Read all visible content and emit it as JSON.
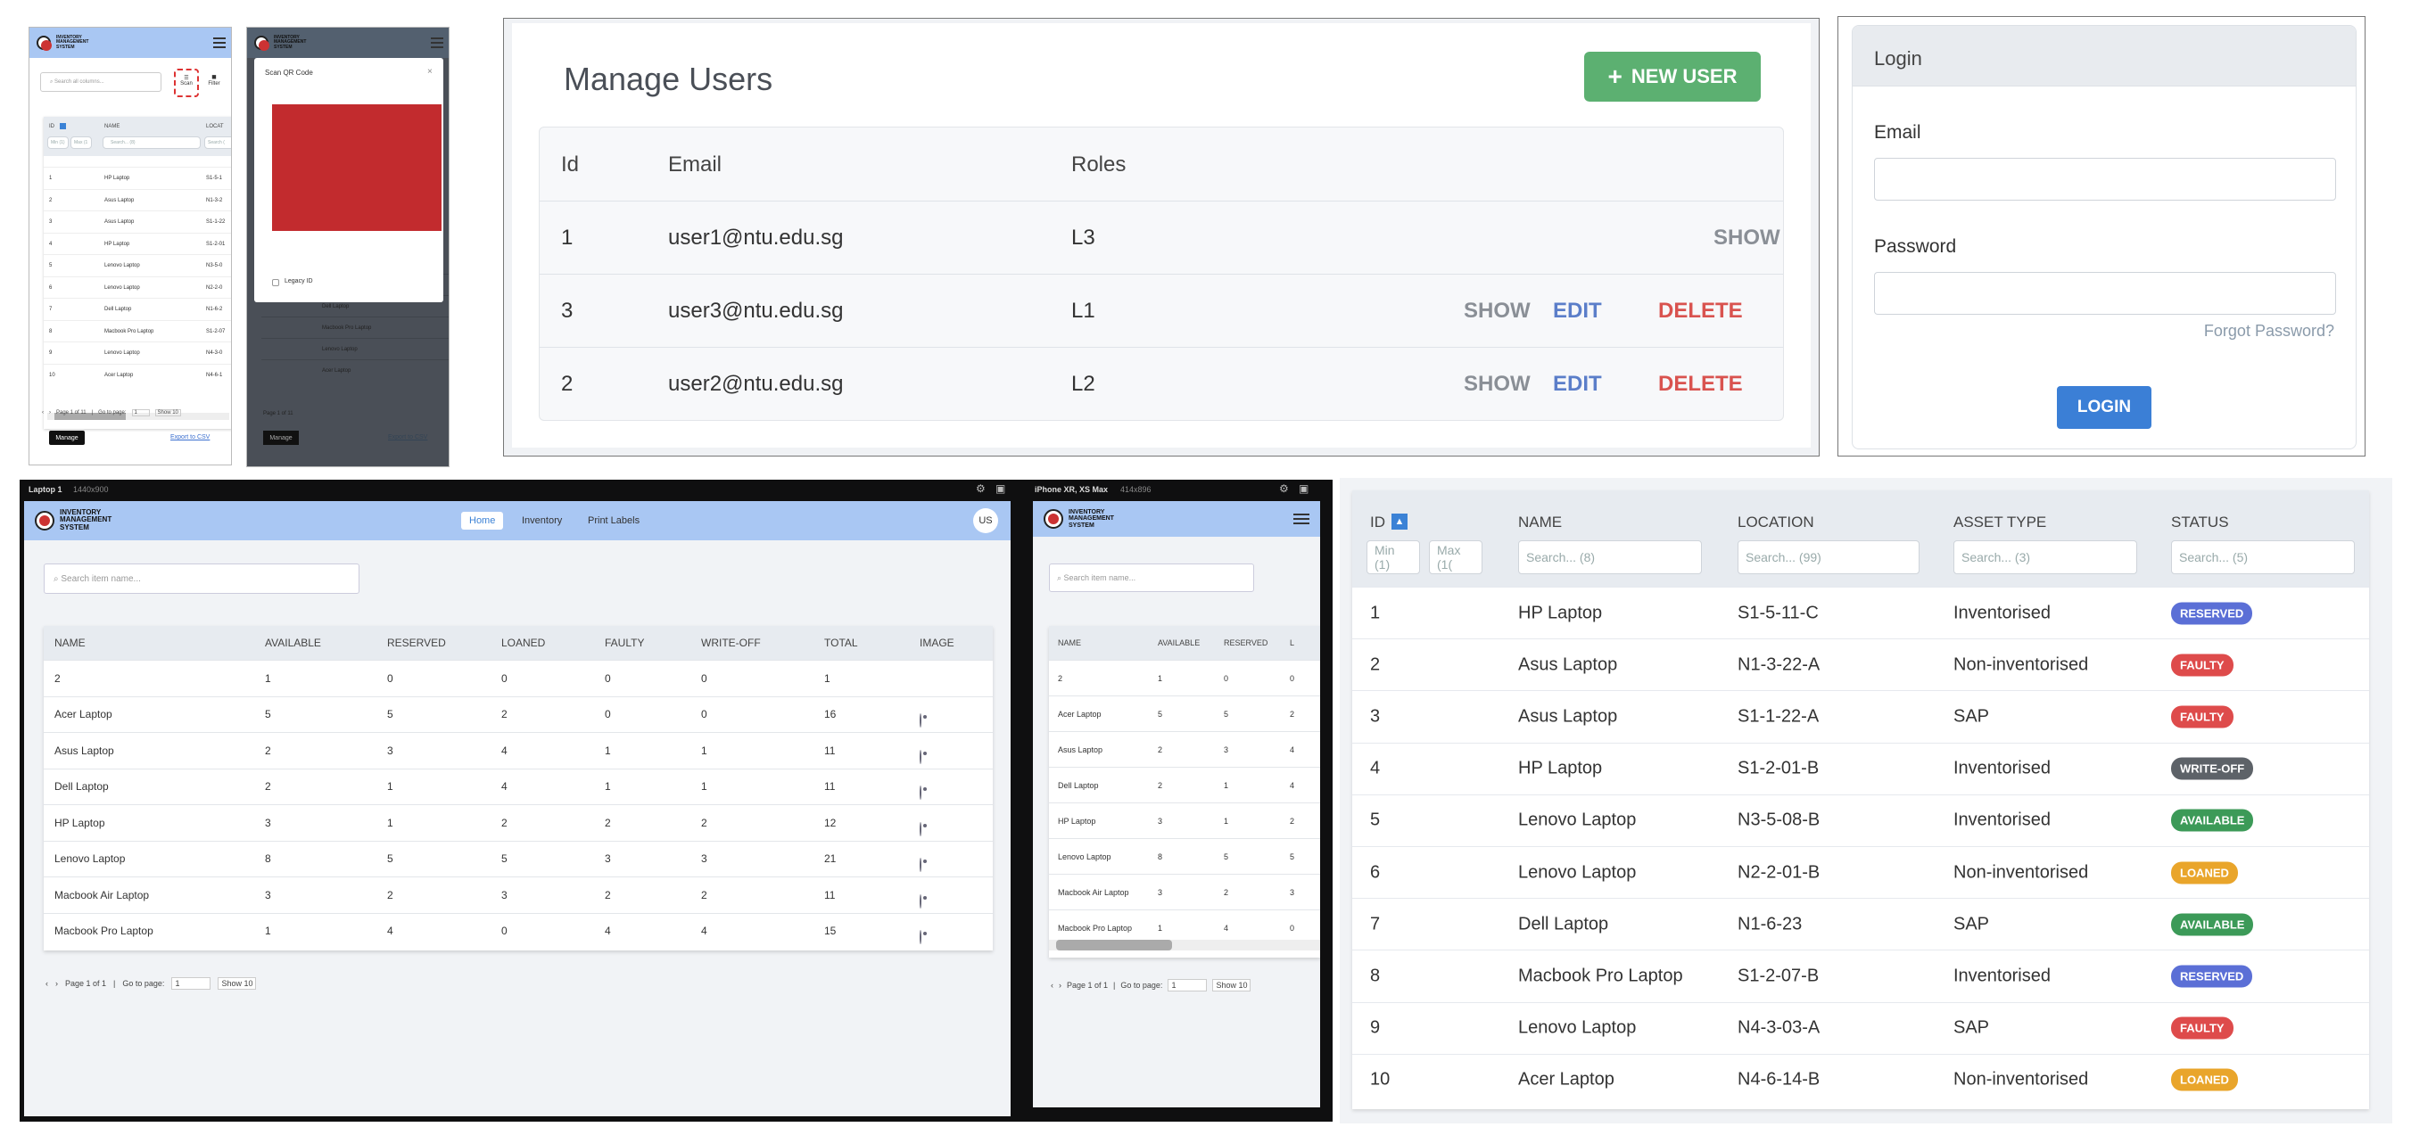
{
  "mobile1": {
    "logo": "INVENTORY MANAGEMENT SYSTEM",
    "search_placeholder": "Search all columns...",
    "scan_label": "Scan",
    "filter_label": "Filter",
    "headers": [
      "ID",
      "NAME",
      "LOCAT"
    ],
    "min": "Min (1)",
    "max": "Max (1",
    "name_ph": "Search... (8)",
    "loc_ph": "Search (",
    "rows": [
      {
        "id": "1",
        "name": "HP Laptop",
        "loc": "S1-5-1"
      },
      {
        "id": "2",
        "name": "Asus Laptop",
        "loc": "N1-3-2"
      },
      {
        "id": "3",
        "name": "Asus Laptop",
        "loc": "S1-1-22"
      },
      {
        "id": "4",
        "name": "HP Laptop",
        "loc": "S1-2-01"
      },
      {
        "id": "5",
        "name": "Lenovo Laptop",
        "loc": "N3-5-0"
      },
      {
        "id": "6",
        "name": "Lenovo Laptop",
        "loc": "N2-2-0"
      },
      {
        "id": "7",
        "name": "Dell Laptop",
        "loc": "N1-6-2"
      },
      {
        "id": "8",
        "name": "Macbook Pro Laptop",
        "loc": "S1-2-07"
      },
      {
        "id": "9",
        "name": "Lenovo Laptop",
        "loc": "N4-3-0"
      },
      {
        "id": "10",
        "name": "Acer Laptop",
        "loc": "N4-6-1"
      }
    ],
    "pager": "Page 1 of 11",
    "goto": "Go to page:",
    "goto_val": "1",
    "show": "Show 10",
    "manage": "Manage",
    "export": "Export to CSV"
  },
  "mobile2": {
    "logo": "INVENTORY MANAGEMENT SYSTEM",
    "modal_title": "Scan QR Code",
    "close": "×",
    "legacy": "Legacy ID",
    "manage": "Manage",
    "export": "Export to CSV",
    "pager": "Page 1 of 11",
    "rows": [
      "Lenovo Laptop",
      "Dell Laptop",
      "Macbook Pro Laptop",
      "Lenovo Laptop",
      "Acer Laptop"
    ]
  },
  "manage_users": {
    "title": "Manage Users",
    "new_user": "NEW USER",
    "headers": {
      "id": "Id",
      "email": "Email",
      "roles": "Roles"
    },
    "rows": [
      {
        "id": "1",
        "email": "user1@ntu.edu.sg",
        "role": "L3",
        "actions": [
          "SHOW"
        ]
      },
      {
        "id": "3",
        "email": "user3@ntu.edu.sg",
        "role": "L1",
        "actions": [
          "SHOW",
          "EDIT",
          "DELETE"
        ]
      },
      {
        "id": "2",
        "email": "user2@ntu.edu.sg",
        "role": "L2",
        "actions": [
          "SHOW",
          "EDIT",
          "DELETE"
        ]
      }
    ],
    "colors": {
      "show": "#8a8f96",
      "edit": "#5b7ec9",
      "delete": "#d9534f",
      "button": "#5cb071"
    }
  },
  "login": {
    "title": "Login",
    "email_label": "Email",
    "password_label": "Password",
    "forgot": "Forgot Password?",
    "button": "LOGIN"
  },
  "laptop": {
    "device": "Laptop 1",
    "size": "1440x900",
    "logo": "INVENTORY MANAGEMENT SYSTEM",
    "nav": [
      "Home",
      "Inventory",
      "Print Labels"
    ],
    "avatar": "US",
    "search_placeholder": "Search item name...",
    "headers": [
      "NAME",
      "AVAILABLE",
      "RESERVED",
      "LOANED",
      "FAULTY",
      "WRITE-OFF",
      "TOTAL",
      "IMAGE"
    ],
    "rows": [
      [
        "2",
        "1",
        "0",
        "0",
        "0",
        "0",
        "1"
      ],
      [
        "Acer Laptop",
        "5",
        "5",
        "2",
        "0",
        "0",
        "16"
      ],
      [
        "Asus Laptop",
        "2",
        "3",
        "4",
        "1",
        "1",
        "11"
      ],
      [
        "Dell Laptop",
        "2",
        "1",
        "4",
        "1",
        "1",
        "11"
      ],
      [
        "HP Laptop",
        "3",
        "1",
        "2",
        "2",
        "2",
        "12"
      ],
      [
        "Lenovo Laptop",
        "8",
        "5",
        "5",
        "3",
        "3",
        "21"
      ],
      [
        "Macbook Air Laptop",
        "3",
        "2",
        "3",
        "2",
        "2",
        "11"
      ],
      [
        "Macbook Pro Laptop",
        "1",
        "4",
        "0",
        "4",
        "4",
        "15"
      ]
    ],
    "pager": "Page 1 of 1",
    "goto": "Go to page:",
    "goto_val": "1",
    "show": "Show 10"
  },
  "iphone": {
    "device": "iPhone XR, XS Max",
    "size": "414x896",
    "logo": "INVENTORY MANAGEMENT SYSTEM",
    "search_placeholder": "Search item name...",
    "headers": [
      "NAME",
      "AVAILABLE",
      "RESERVED",
      "L"
    ],
    "rows": [
      [
        "2",
        "1",
        "0",
        "0"
      ],
      [
        "Acer Laptop",
        "5",
        "5",
        "2"
      ],
      [
        "Asus Laptop",
        "2",
        "3",
        "4"
      ],
      [
        "Dell Laptop",
        "2",
        "1",
        "4"
      ],
      [
        "HP Laptop",
        "3",
        "1",
        "2"
      ],
      [
        "Lenovo Laptop",
        "8",
        "5",
        "5"
      ],
      [
        "Macbook Air Laptop",
        "3",
        "2",
        "3"
      ],
      [
        "Macbook Pro Laptop",
        "1",
        "4",
        "0"
      ]
    ],
    "pager": "Page 1 of 1",
    "goto": "Go to page:",
    "goto_val": "1",
    "show": "Show 10"
  },
  "assets": {
    "headers": {
      "id": "ID",
      "name": "NAME",
      "location": "LOCATION",
      "type": "ASSET TYPE",
      "status": "STATUS"
    },
    "filters": {
      "min": "Min (1)",
      "max": "Max (1(",
      "name": "Search... (8)",
      "location": "Search... (99)",
      "type": "Search... (3)",
      "status": "Search... (5)"
    },
    "rows": [
      {
        "id": "1",
        "name": "HP Laptop",
        "loc": "S1-5-11-C",
        "type": "Inventorised",
        "status": "RESERVED",
        "color": "#5b6fd6"
      },
      {
        "id": "2",
        "name": "Asus Laptop",
        "loc": "N1-3-22-A",
        "type": "Non-inventorised",
        "status": "FAULTY",
        "color": "#de4b4b"
      },
      {
        "id": "3",
        "name": "Asus Laptop",
        "loc": "S1-1-22-A",
        "type": "SAP",
        "status": "FAULTY",
        "color": "#de4b4b"
      },
      {
        "id": "4",
        "name": "HP Laptop",
        "loc": "S1-2-01-B",
        "type": "Inventorised",
        "status": "WRITE-OFF",
        "color": "#5d6268"
      },
      {
        "id": "5",
        "name": "Lenovo Laptop",
        "loc": "N3-5-08-B",
        "type": "Inventorised",
        "status": "AVAILABLE",
        "color": "#3c9a58"
      },
      {
        "id": "6",
        "name": "Lenovo Laptop",
        "loc": "N2-2-01-B",
        "type": "Non-inventorised",
        "status": "LOANED",
        "color": "#e9a52b"
      },
      {
        "id": "7",
        "name": "Dell Laptop",
        "loc": "N1-6-23",
        "type": "SAP",
        "status": "AVAILABLE",
        "color": "#3c9a58"
      },
      {
        "id": "8",
        "name": "Macbook Pro Laptop",
        "loc": "S1-2-07-B",
        "type": "Inventorised",
        "status": "RESERVED",
        "color": "#5b6fd6"
      },
      {
        "id": "9",
        "name": "Lenovo Laptop",
        "loc": "N4-3-03-A",
        "type": "SAP",
        "status": "FAULTY",
        "color": "#de4b4b"
      },
      {
        "id": "10",
        "name": "Acer Laptop",
        "loc": "N4-6-14-B",
        "type": "Non-inventorised",
        "status": "LOANED",
        "color": "#e9a52b"
      }
    ]
  }
}
